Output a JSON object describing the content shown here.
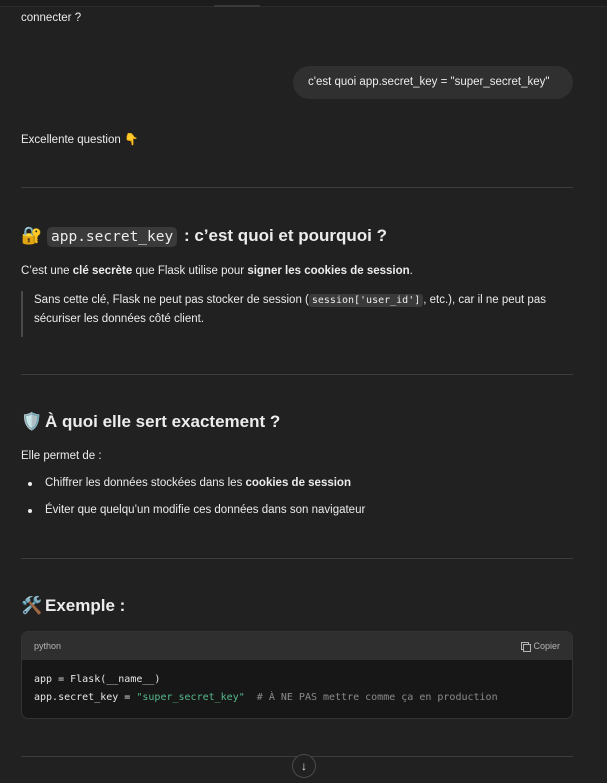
{
  "top_text": "connecter ?",
  "user_message": "c'est quoi app.secret_key = \"super_secret_key\"",
  "intro": {
    "text": "Excellente question",
    "emoji": "👇"
  },
  "section1": {
    "emoji": "🔐",
    "code": "app.secret_key",
    "title_rest": ": c’est quoi et pourquoi ?",
    "para_a": "C’est une ",
    "para_b": "clé secrète",
    "para_c": " que Flask utilise pour ",
    "para_d": "signer les cookies de session",
    "para_e": ".",
    "quote_a": "Sans cette clé, Flask ne peut pas stocker de session (",
    "quote_code": "session['user_id']",
    "quote_b": ", etc.), car il ne peut pas sécuriser les données côté client."
  },
  "section2": {
    "emoji": "🛡️",
    "title": "À quoi elle sert exactement ?",
    "lead": "Elle permet de :",
    "item1_a": "Chiffrer les données stockées dans les ",
    "item1_b": "cookies de session",
    "item2": "Éviter que quelqu’un modifie ces données dans son navigateur"
  },
  "section3": {
    "emoji": "🛠️",
    "title": "Exemple :",
    "code_lang": "python",
    "copy_label": "Copier",
    "line1": "app = Flask(__name__)",
    "line2_a": "app.secret_key = ",
    "line2_str": "\"super_secret_key\"",
    "line2_cmt": "  # À NE PAS mettre comme ça en production"
  },
  "scroll_icon": "arrow-down-icon"
}
